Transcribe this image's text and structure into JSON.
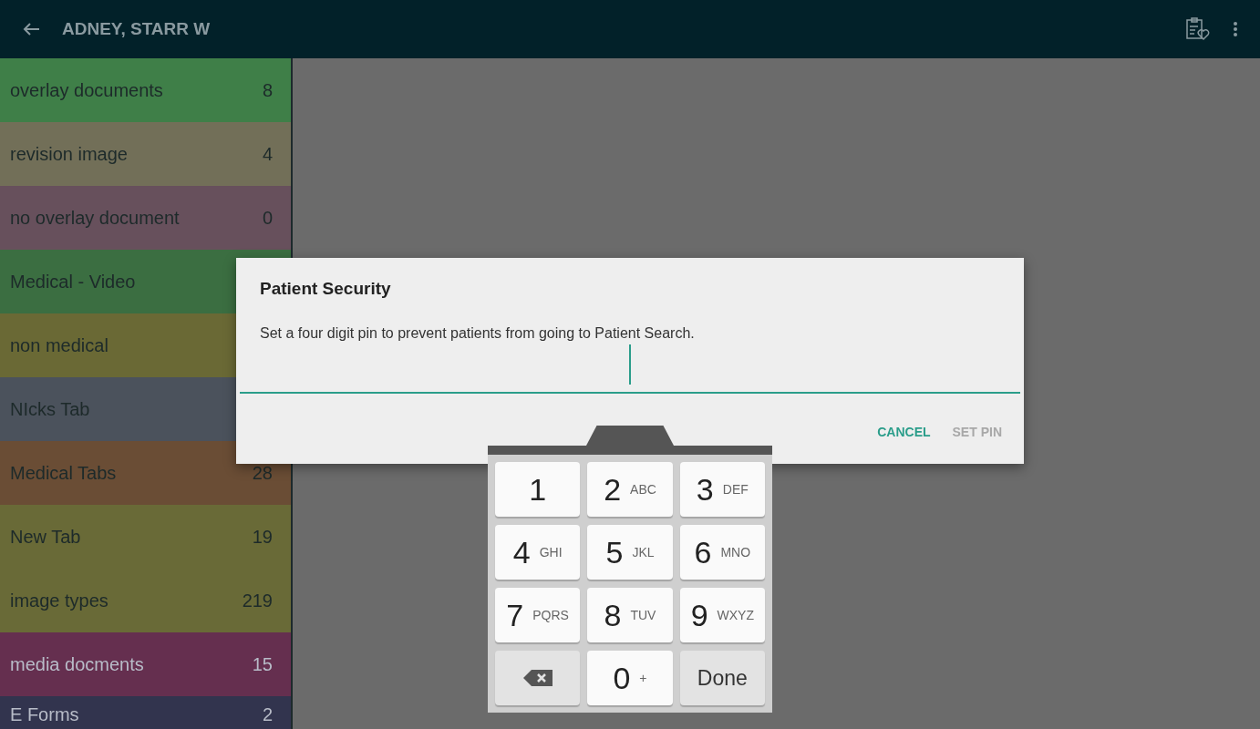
{
  "app_bar": {
    "title": "ADNEY, STARR W"
  },
  "sidebar": {
    "items": [
      {
        "label": "overlay documents",
        "count": "8",
        "color": "#3f7f48"
      },
      {
        "label": "revision image",
        "count": "4",
        "color": "#726f58"
      },
      {
        "label": "no overlay document",
        "count": "0",
        "color": "#67505c"
      },
      {
        "label": "Medical - Video",
        "color": "#3b6e41"
      },
      {
        "label": "non medical",
        "color": "#6a6935"
      },
      {
        "label": "NIcks Tab",
        "color": "#4b525c"
      },
      {
        "label": "Medical Tabs",
        "count": "28",
        "color": "#6a4d35"
      },
      {
        "label": "New Tab",
        "count": "19",
        "color": "#696a37"
      },
      {
        "label": "image types",
        "count": "219",
        "color": "#696a37"
      },
      {
        "label": "media docments",
        "count": "15",
        "color": "#652f4f"
      },
      {
        "label": "E Forms",
        "count": "2",
        "color": "#32344e"
      }
    ]
  },
  "dialog": {
    "title": "Patient Security",
    "message": "Set a four digit pin to prevent patients from going to Patient Search.",
    "buttons": [
      {
        "label": "CANCEL",
        "disabled": false
      },
      {
        "label": "SET PIN",
        "disabled": true
      }
    ]
  },
  "keypad": {
    "keys": [
      {
        "kind": "digit",
        "label": "1"
      },
      {
        "kind": "digit",
        "label": "2",
        "letters": "ABC"
      },
      {
        "kind": "digit",
        "label": "3",
        "letters": "DEF"
      },
      {
        "kind": "digit",
        "label": "4",
        "letters": "GHI"
      },
      {
        "kind": "digit",
        "label": "5",
        "letters": "JKL"
      },
      {
        "kind": "digit",
        "label": "6",
        "letters": "MNO"
      },
      {
        "kind": "digit",
        "label": "7",
        "letters": "PQRS"
      },
      {
        "kind": "digit",
        "label": "8",
        "letters": "TUV"
      },
      {
        "kind": "digit",
        "label": "9",
        "letters": "WXYZ"
      },
      {
        "kind": "backspace"
      },
      {
        "kind": "digit",
        "label": "0",
        "letters": "+"
      },
      {
        "kind": "done",
        "label": "Done"
      }
    ]
  }
}
